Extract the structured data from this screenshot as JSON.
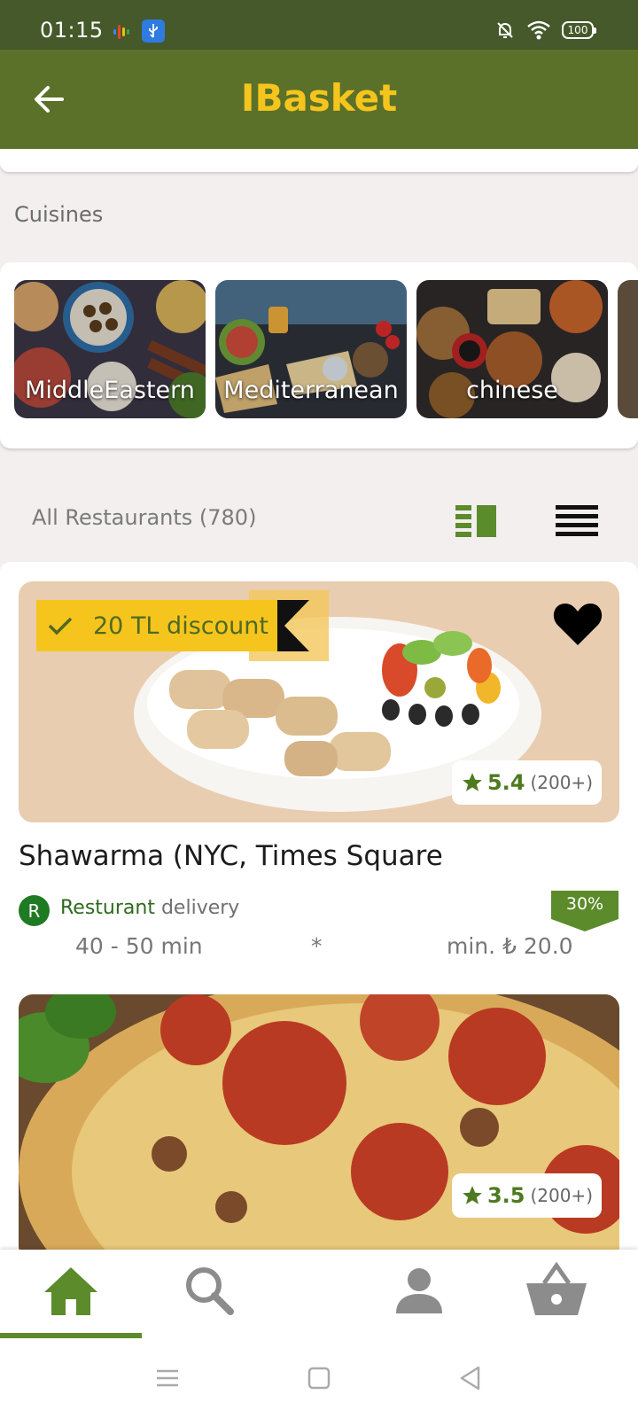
{
  "status_bar": {
    "time": "01:15",
    "battery": "100"
  },
  "app_bar": {
    "title": "IBasket",
    "back_icon": "arrow-left-icon"
  },
  "cuisines_section": {
    "title": "Cuisines",
    "items": [
      {
        "label": "MiddleEastern"
      },
      {
        "label": "Mediterranean"
      },
      {
        "label": "chinese"
      }
    ]
  },
  "restaurants_header": {
    "label": "All Restaurants (780)"
  },
  "restaurants": [
    {
      "discount": "20 TL discount",
      "rating": "5.4",
      "rating_count": "(200+)",
      "name": "Shawarma (NYC, Times Square",
      "badge_letter": "R",
      "type_label": "Resturant",
      "delivery_label": "delivery",
      "percent_badge": "30%",
      "delivery_time": "40 - 50 min",
      "separator": "*",
      "min_order": "min. ₺ 20.0"
    },
    {
      "rating": "3.5",
      "rating_count": "(200+)"
    }
  ],
  "bottom_nav": [
    {
      "icon": "home-icon",
      "active": true
    },
    {
      "icon": "search-icon",
      "active": false
    },
    {
      "icon": "profile-icon",
      "active": false
    },
    {
      "icon": "basket-icon",
      "active": false
    }
  ],
  "colors": {
    "status_bar": "#45592a",
    "app_bar": "#5b7129",
    "title": "#f6c51d",
    "accent_green": "#5b8b2a",
    "discount_bg": "#f6c51d"
  }
}
